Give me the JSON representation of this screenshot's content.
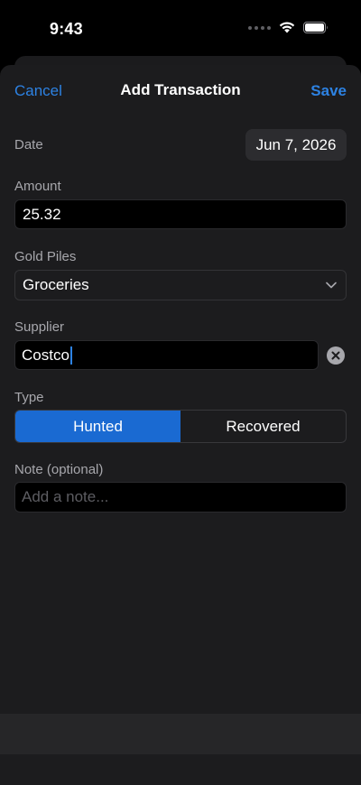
{
  "status": {
    "time": "9:43"
  },
  "nav": {
    "cancel": "Cancel",
    "title": "Add Transaction",
    "save": "Save"
  },
  "form": {
    "date": {
      "label": "Date",
      "value": "Jun 7, 2026"
    },
    "amount": {
      "label": "Amount",
      "value": "25.32"
    },
    "gold_piles": {
      "label": "Gold Piles",
      "value": "Groceries"
    },
    "supplier": {
      "label": "Supplier",
      "value": "Costco"
    },
    "type": {
      "label": "Type",
      "options": [
        "Hunted",
        "Recovered"
      ],
      "selected": "Hunted"
    },
    "note": {
      "label": "Note (optional)",
      "placeholder": "Add a note..."
    }
  },
  "colors": {
    "accent": "#2d82e3",
    "segment_active": "#1a6ad2",
    "sheet": "#1c1c1e"
  },
  "icons": [
    "wifi-icon",
    "battery-icon",
    "chevron-down-icon",
    "clear-icon"
  ]
}
